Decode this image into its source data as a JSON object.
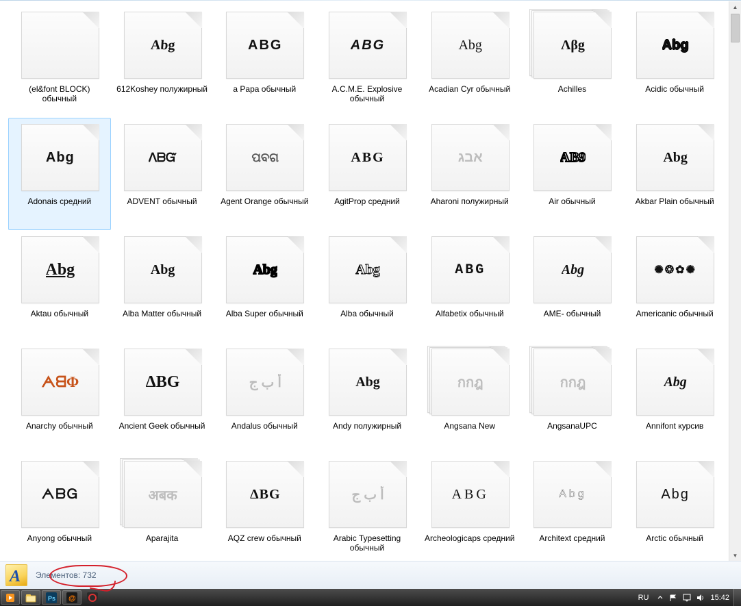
{
  "status": {
    "label": "Элементов:",
    "count": "732"
  },
  "tray": {
    "lang": "RU",
    "clock": "15:42"
  },
  "items": [
    {
      "name": "(el&font BLOCK) обычный",
      "preview": "",
      "stack": false,
      "selected": false,
      "style": ""
    },
    {
      "name": "612Koshey полужирный",
      "preview": "Abg",
      "stack": false,
      "selected": false,
      "style": "font-family:'Comic Sans MS',cursive;transform:skewX(-4deg);"
    },
    {
      "name": "a Papa обычный",
      "preview": "ABG",
      "stack": false,
      "selected": false,
      "style": "font-family:Arial;letter-spacing:2px;font-weight:900;"
    },
    {
      "name": "A.C.M.E. Explosive обычный",
      "preview": "ABG",
      "stack": false,
      "selected": false,
      "style": "font-family:Impact,Arial;font-style:italic;letter-spacing:2px;"
    },
    {
      "name": "Acadian Cyr обычный",
      "preview": "Abg",
      "stack": false,
      "selected": false,
      "style": "font-family:'Times New Roman',serif;font-weight:normal;"
    },
    {
      "name": "Achilles",
      "preview": "Λβg",
      "stack": true,
      "selected": false,
      "style": "font-family:'Times New Roman',serif;"
    },
    {
      "name": "Acidic обычный",
      "preview": "Abg",
      "stack": false,
      "selected": false,
      "style": "font-family:Arial;text-shadow:1px 0 #000,-1px 0 #000,0 1px #000,0 -1px #000;"
    },
    {
      "name": "Adonais средний",
      "preview": "Abg",
      "stack": false,
      "selected": true,
      "style": "font-family:Arial Black,Arial;font-weight:900;letter-spacing:1px;"
    },
    {
      "name": "ADVENT обычный",
      "preview": "ᐱᗷᏳ",
      "stack": false,
      "selected": false,
      "style": "font-family:Arial;font-weight:900;font-size:18px;"
    },
    {
      "name": "Agent Orange обычный",
      "preview": "ପବଗ",
      "stack": false,
      "selected": false,
      "style": "font-family:Arial;color:#555;font-size:18px;"
    },
    {
      "name": "AgitProp средний",
      "preview": "ABG",
      "stack": false,
      "selected": false,
      "style": "font-family:Arial Black;font-weight:900;letter-spacing:2px;"
    },
    {
      "name": "Aharoni полужирный",
      "preview": "אבג",
      "stack": false,
      "selected": false,
      "style": "direction:rtl;color:#bdbdbd;font-family:Arial;"
    },
    {
      "name": "Air обычный",
      "preview": "AB9",
      "stack": false,
      "selected": false,
      "style": "font-family:Arial Black;-webkit-text-stroke:2px #000;color:#fff;"
    },
    {
      "name": "Akbar Plain обычный",
      "preview": "Abg",
      "stack": false,
      "selected": false,
      "style": "font-family:'Comic Sans MS',cursive;"
    },
    {
      "name": "Aktau обычный",
      "preview": "Abg",
      "stack": false,
      "selected": false,
      "style": "font-family:Arial Black;font-weight:900;text-decoration:underline;font-size:24px;"
    },
    {
      "name": "Alba Matter обычный",
      "preview": "Abg",
      "stack": false,
      "selected": false,
      "style": "font-family:Arial Black;font-weight:900;"
    },
    {
      "name": "Alba Super обычный",
      "preview": "Abg",
      "stack": false,
      "selected": false,
      "style": "font-family:Arial Black;-webkit-text-stroke:2px #000;color:#000;"
    },
    {
      "name": "Alba обычный",
      "preview": "Abg",
      "stack": false,
      "selected": false,
      "style": "font-family:Arial Black;-webkit-text-stroke:1px #000;color:#fff;"
    },
    {
      "name": "Alfabetix обычный",
      "preview": "ABG",
      "stack": false,
      "selected": false,
      "style": "font-family:'Courier New',monospace;letter-spacing:3px;"
    },
    {
      "name": "AME- обычный",
      "preview": "Abg",
      "stack": false,
      "selected": false,
      "style": "font-family:Impact;font-style:italic;"
    },
    {
      "name": "Americanic обычный",
      "preview": "✺❂✿✺",
      "stack": false,
      "selected": false,
      "style": "font-size:16px;letter-spacing:2px;"
    },
    {
      "name": "Anarchy обычный",
      "preview": "ᗅᗺΦ",
      "stack": false,
      "selected": false,
      "style": "font-family:Arial Black;font-weight:900;font-size:22px;",
      "cls": "c-orange"
    },
    {
      "name": "Ancient Geek обычный",
      "preview": "ΔBG",
      "stack": false,
      "selected": false,
      "style": "font-family:'Times New Roman',serif;font-size:24px;"
    },
    {
      "name": "Andalus обычный",
      "preview": "أ ب ج",
      "stack": false,
      "selected": false,
      "style": "direction:rtl;color:#bdbdbd;font-family:'Times New Roman',serif;"
    },
    {
      "name": "Andy полужирный",
      "preview": "Abg",
      "stack": false,
      "selected": false,
      "style": "font-family:'Comic Sans MS',cursive;font-weight:bold;"
    },
    {
      "name": "Angsana New",
      "preview": "กกฎ",
      "stack": true,
      "selected": false,
      "style": "font-family:'Times New Roman',serif;color:#bdbdbd;"
    },
    {
      "name": "AngsanaUPC",
      "preview": "กกฎ",
      "stack": true,
      "selected": false,
      "style": "font-family:'Times New Roman',serif;color:#bdbdbd;"
    },
    {
      "name": "Annifont курсив",
      "preview": "Abg",
      "stack": false,
      "selected": false,
      "style": "font-style:italic;font-family:'Segoe Script','Comic Sans MS',cursive;"
    },
    {
      "name": "Anyong обычный",
      "preview": "ᗅᗷᏀ",
      "stack": false,
      "selected": false,
      "style": "font-family:Arial;font-weight:900;letter-spacing:2px;"
    },
    {
      "name": "Aparajita",
      "preview": "अबक",
      "stack": true,
      "selected": false,
      "style": "font-family:'Times New Roman',serif;color:#bdbdbd;"
    },
    {
      "name": "AQZ crew обычный",
      "preview": "ΔBG",
      "stack": false,
      "selected": false,
      "style": "font-family:Arial Black;font-weight:900;letter-spacing:1px;"
    },
    {
      "name": "Arabic Typesetting обычный",
      "preview": "أ ب ج",
      "stack": false,
      "selected": false,
      "style": "direction:rtl;color:#bdbdbd;font-family:'Times New Roman',serif;"
    },
    {
      "name": "Archeologicaps средний",
      "preview": "ABG",
      "stack": false,
      "selected": false,
      "style": "font-family:'Times New Roman',serif;letter-spacing:4px;font-weight:normal;"
    },
    {
      "name": "Architext средний",
      "preview": "Abg",
      "stack": false,
      "selected": false,
      "style": "font-family:Arial;font-weight:100;letter-spacing:4px;-webkit-text-stroke:.3px #000;color:#fff;font-size:16px;"
    },
    {
      "name": "Arctic обычный",
      "preview": "Abg",
      "stack": false,
      "selected": false,
      "style": "font-family:'Century Gothic',Arial;font-weight:normal;letter-spacing:2px;"
    }
  ]
}
